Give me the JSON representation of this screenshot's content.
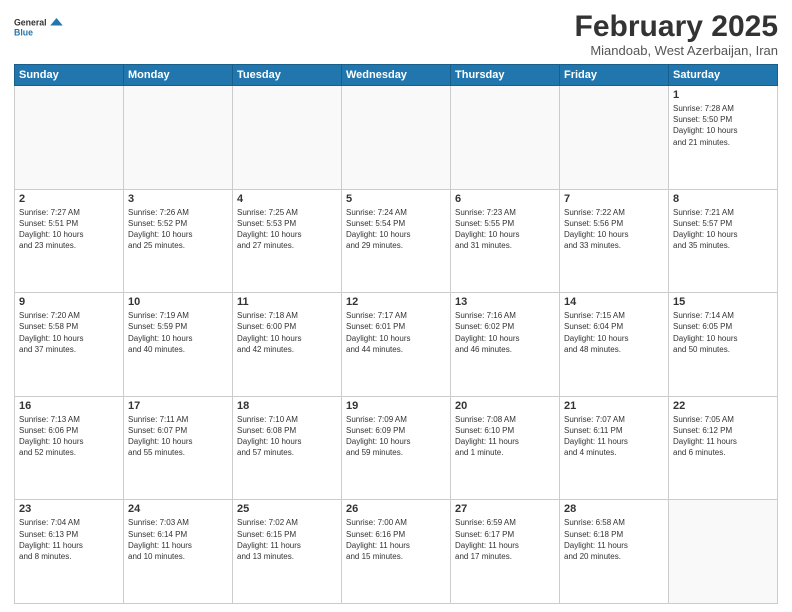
{
  "header": {
    "logo_general": "General",
    "logo_blue": "Blue",
    "month_title": "February 2025",
    "location": "Miandoab, West Azerbaijan, Iran"
  },
  "days_of_week": [
    "Sunday",
    "Monday",
    "Tuesday",
    "Wednesday",
    "Thursday",
    "Friday",
    "Saturday"
  ],
  "weeks": [
    [
      {
        "day": "",
        "info": ""
      },
      {
        "day": "",
        "info": ""
      },
      {
        "day": "",
        "info": ""
      },
      {
        "day": "",
        "info": ""
      },
      {
        "day": "",
        "info": ""
      },
      {
        "day": "",
        "info": ""
      },
      {
        "day": "1",
        "info": "Sunrise: 7:28 AM\nSunset: 5:50 PM\nDaylight: 10 hours\nand 21 minutes."
      }
    ],
    [
      {
        "day": "2",
        "info": "Sunrise: 7:27 AM\nSunset: 5:51 PM\nDaylight: 10 hours\nand 23 minutes."
      },
      {
        "day": "3",
        "info": "Sunrise: 7:26 AM\nSunset: 5:52 PM\nDaylight: 10 hours\nand 25 minutes."
      },
      {
        "day": "4",
        "info": "Sunrise: 7:25 AM\nSunset: 5:53 PM\nDaylight: 10 hours\nand 27 minutes."
      },
      {
        "day": "5",
        "info": "Sunrise: 7:24 AM\nSunset: 5:54 PM\nDaylight: 10 hours\nand 29 minutes."
      },
      {
        "day": "6",
        "info": "Sunrise: 7:23 AM\nSunset: 5:55 PM\nDaylight: 10 hours\nand 31 minutes."
      },
      {
        "day": "7",
        "info": "Sunrise: 7:22 AM\nSunset: 5:56 PM\nDaylight: 10 hours\nand 33 minutes."
      },
      {
        "day": "8",
        "info": "Sunrise: 7:21 AM\nSunset: 5:57 PM\nDaylight: 10 hours\nand 35 minutes."
      }
    ],
    [
      {
        "day": "9",
        "info": "Sunrise: 7:20 AM\nSunset: 5:58 PM\nDaylight: 10 hours\nand 37 minutes."
      },
      {
        "day": "10",
        "info": "Sunrise: 7:19 AM\nSunset: 5:59 PM\nDaylight: 10 hours\nand 40 minutes."
      },
      {
        "day": "11",
        "info": "Sunrise: 7:18 AM\nSunset: 6:00 PM\nDaylight: 10 hours\nand 42 minutes."
      },
      {
        "day": "12",
        "info": "Sunrise: 7:17 AM\nSunset: 6:01 PM\nDaylight: 10 hours\nand 44 minutes."
      },
      {
        "day": "13",
        "info": "Sunrise: 7:16 AM\nSunset: 6:02 PM\nDaylight: 10 hours\nand 46 minutes."
      },
      {
        "day": "14",
        "info": "Sunrise: 7:15 AM\nSunset: 6:04 PM\nDaylight: 10 hours\nand 48 minutes."
      },
      {
        "day": "15",
        "info": "Sunrise: 7:14 AM\nSunset: 6:05 PM\nDaylight: 10 hours\nand 50 minutes."
      }
    ],
    [
      {
        "day": "16",
        "info": "Sunrise: 7:13 AM\nSunset: 6:06 PM\nDaylight: 10 hours\nand 52 minutes."
      },
      {
        "day": "17",
        "info": "Sunrise: 7:11 AM\nSunset: 6:07 PM\nDaylight: 10 hours\nand 55 minutes."
      },
      {
        "day": "18",
        "info": "Sunrise: 7:10 AM\nSunset: 6:08 PM\nDaylight: 10 hours\nand 57 minutes."
      },
      {
        "day": "19",
        "info": "Sunrise: 7:09 AM\nSunset: 6:09 PM\nDaylight: 10 hours\nand 59 minutes."
      },
      {
        "day": "20",
        "info": "Sunrise: 7:08 AM\nSunset: 6:10 PM\nDaylight: 11 hours\nand 1 minute."
      },
      {
        "day": "21",
        "info": "Sunrise: 7:07 AM\nSunset: 6:11 PM\nDaylight: 11 hours\nand 4 minutes."
      },
      {
        "day": "22",
        "info": "Sunrise: 7:05 AM\nSunset: 6:12 PM\nDaylight: 11 hours\nand 6 minutes."
      }
    ],
    [
      {
        "day": "23",
        "info": "Sunrise: 7:04 AM\nSunset: 6:13 PM\nDaylight: 11 hours\nand 8 minutes."
      },
      {
        "day": "24",
        "info": "Sunrise: 7:03 AM\nSunset: 6:14 PM\nDaylight: 11 hours\nand 10 minutes."
      },
      {
        "day": "25",
        "info": "Sunrise: 7:02 AM\nSunset: 6:15 PM\nDaylight: 11 hours\nand 13 minutes."
      },
      {
        "day": "26",
        "info": "Sunrise: 7:00 AM\nSunset: 6:16 PM\nDaylight: 11 hours\nand 15 minutes."
      },
      {
        "day": "27",
        "info": "Sunrise: 6:59 AM\nSunset: 6:17 PM\nDaylight: 11 hours\nand 17 minutes."
      },
      {
        "day": "28",
        "info": "Sunrise: 6:58 AM\nSunset: 6:18 PM\nDaylight: 11 hours\nand 20 minutes."
      },
      {
        "day": "",
        "info": ""
      }
    ]
  ]
}
